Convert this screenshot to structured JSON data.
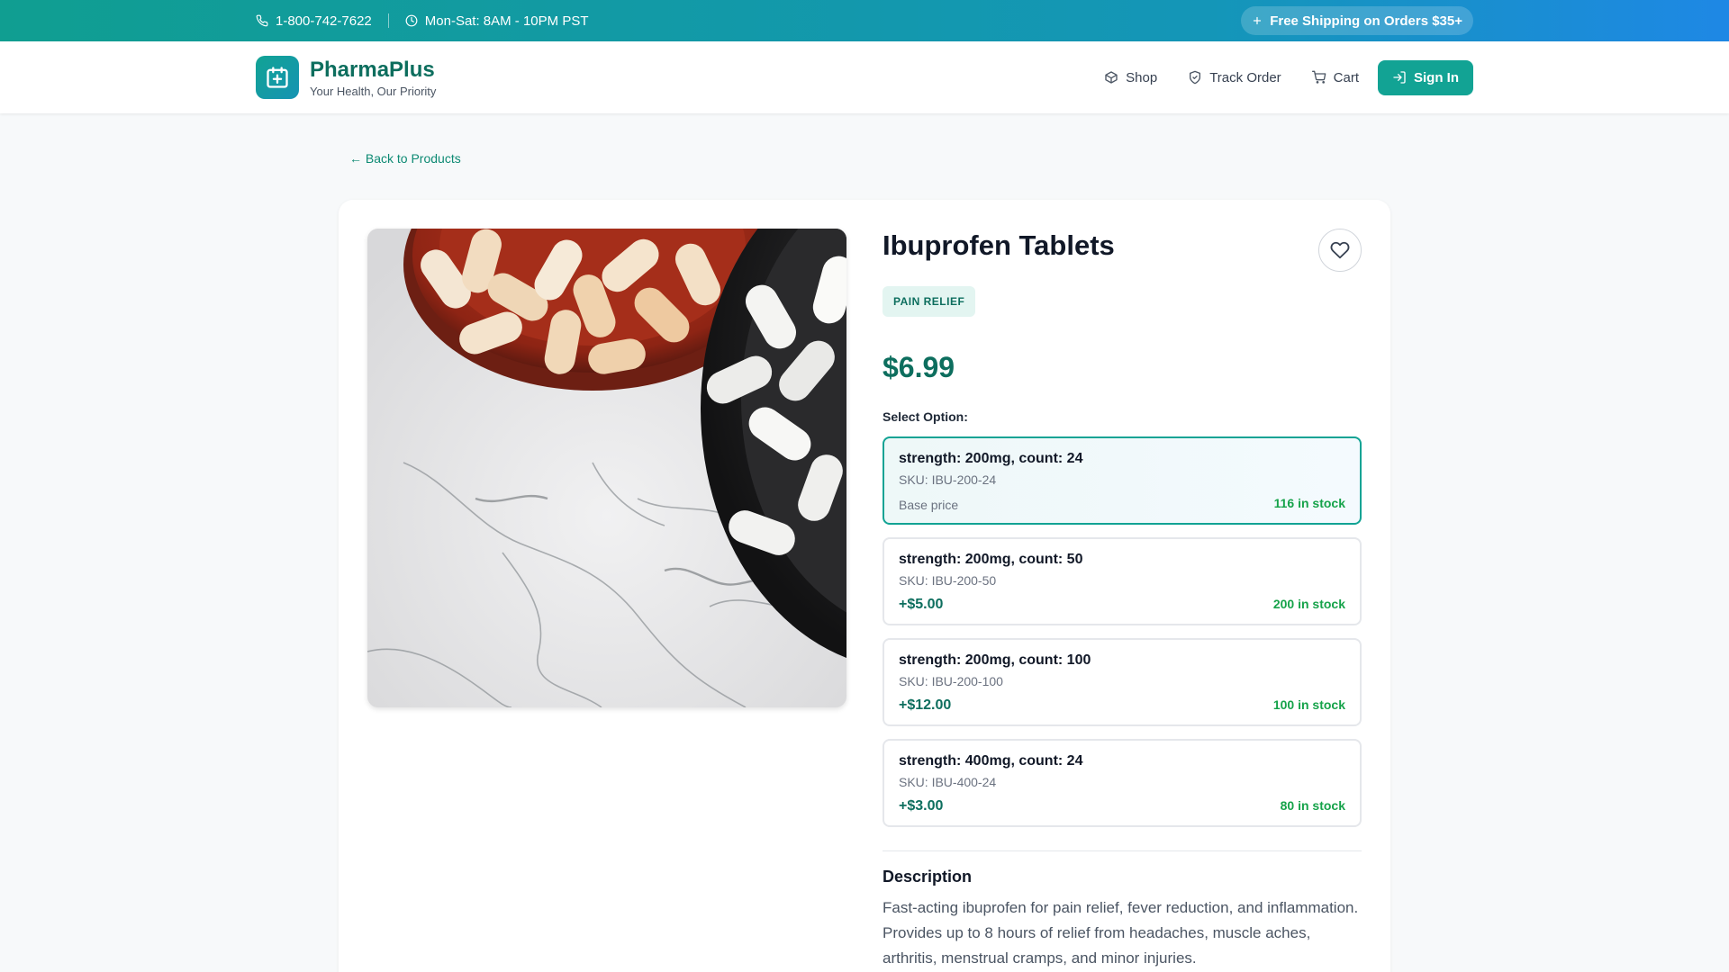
{
  "topbar": {
    "phone": "1-800-742-7622",
    "hours": "Mon-Sat: 8AM - 10PM PST",
    "promo": "Free Shipping on Orders $35+"
  },
  "header": {
    "brand_name": "PharmaPlus",
    "tagline": "Your Health, Our Priority",
    "nav": {
      "shop": "Shop",
      "track": "Track Order",
      "cart": "Cart",
      "signin": "Sign In"
    }
  },
  "main": {
    "back_link": "← Back to Products",
    "product": {
      "title": "Ibuprofen Tablets",
      "category": "PAIN RELIEF",
      "price": "$6.99",
      "select_label": "Select Option:",
      "options": [
        {
          "title": "strength: 200mg, count: 24",
          "sku": "SKU: IBU-200-24",
          "price": "Base price",
          "stock": "116 in stock"
        },
        {
          "title": "strength: 200mg, count: 50",
          "sku": "SKU: IBU-200-50",
          "price": "+$5.00",
          "stock": "200 in stock"
        },
        {
          "title": "strength: 200mg, count: 100",
          "sku": "SKU: IBU-200-100",
          "price": "+$12.00",
          "stock": "100 in stock"
        },
        {
          "title": "strength: 400mg, count: 24",
          "sku": "SKU: IBU-400-24",
          "price": "+$3.00",
          "stock": "80 in stock"
        }
      ],
      "description_heading": "Description",
      "description": "Fast-acting ibuprofen for pain relief, fever reduction, and inflammation. Provides up to 8 hours of relief from headaches, muscle aches, arthritis, menstrual cramps, and minor injuries."
    }
  },
  "colors": {
    "brand": "#12a394",
    "brand_dark": "#0d6e5e",
    "stock_green": "#16a34a"
  },
  "icons": [
    "phone-icon",
    "clock-icon",
    "plus-icon",
    "pharmacy-logo-icon",
    "box-icon",
    "shield-icon",
    "cart-icon",
    "login-icon",
    "heart-icon"
  ]
}
